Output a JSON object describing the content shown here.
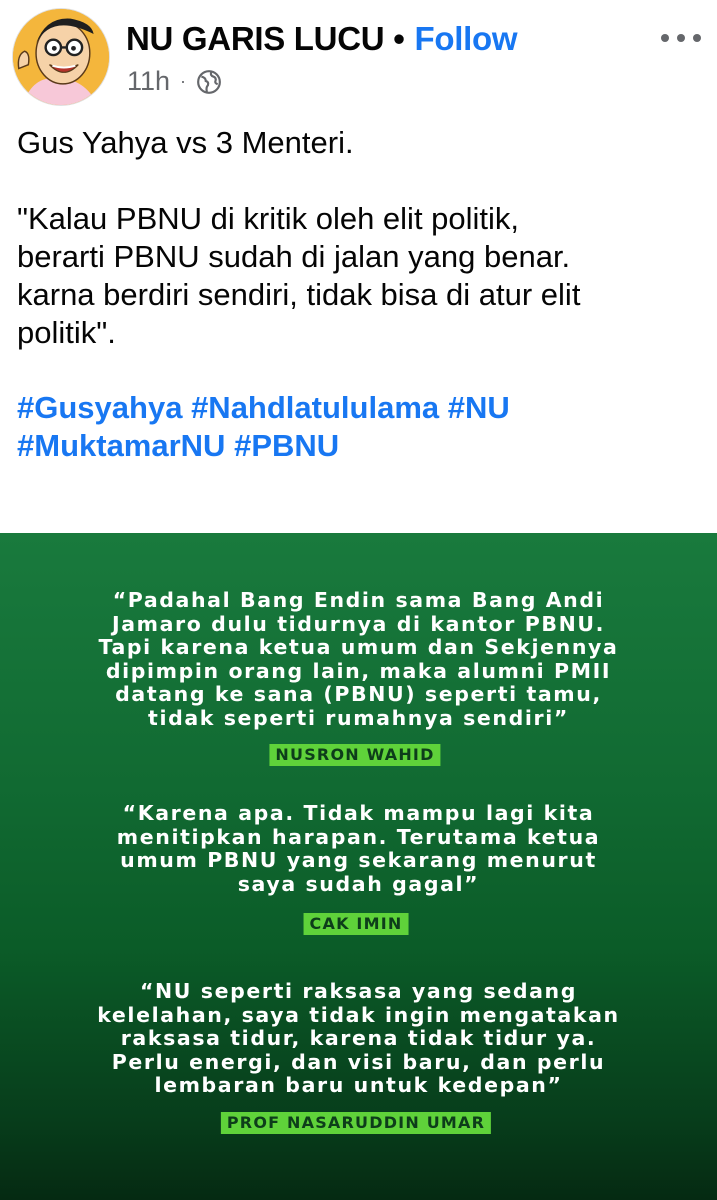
{
  "post": {
    "page_name": "NU GARIS LUCU",
    "separator": "•",
    "follow_label": "Follow",
    "time": "11h",
    "meta_separator": "·",
    "privacy_icon": "globe-icon",
    "more_icon": "more-options-icon",
    "text": {
      "line1": "Gus Yahya vs 3 Menteri.",
      "quote_lines": [
        "\"Kalau PBNU di kritik oleh elit politik,",
        "berarti PBNU sudah di jalan yang benar.",
        "karna berdiri sendiri, tidak bisa di atur elit",
        "politik\"."
      ],
      "hashtags": [
        "#Gusyahya",
        "#Nahdlatululama",
        "#NU",
        "#MuktamarNU",
        "#PBNU"
      ]
    }
  },
  "image": {
    "colors": {
      "background": "#116a32",
      "tag": "#5fd23a"
    },
    "quotes": [
      {
        "lines": [
          "“Padahal Bang Endin sama Bang Andi",
          "Jamaro dulu tidurnya di kantor PBNU.",
          "Tapi karena ketua umum dan Sekjennya",
          "dipimpin orang lain, maka alumni PMII",
          "datang ke sana (PBNU) seperti tamu,",
          "tidak seperti rumahnya sendiri”"
        ],
        "speaker": "NUSRON WAHID"
      },
      {
        "lines": [
          "“Karena apa. Tidak mampu lagi kita",
          "menitipkan harapan. Terutama ketua",
          "umum PBNU yang sekarang menurut",
          "saya sudah gagal”"
        ],
        "speaker": "CAK IMIN"
      },
      {
        "lines": [
          "“NU seperti raksasa yang sedang",
          "kelelahan, saya tidak ingin mengatakan",
          "raksasa tidur, karena tidak tidur ya.",
          "Perlu energi, dan visi baru, dan perlu",
          "lembaran baru untuk kedepan”"
        ],
        "speaker": "PROF NASARUDDIN UMAR"
      }
    ]
  }
}
